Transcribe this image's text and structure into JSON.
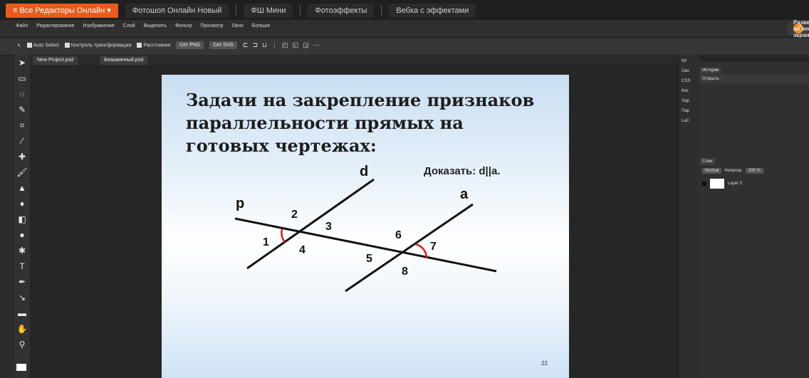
{
  "topbar": {
    "tabs": [
      {
        "label": "≡ Все Редакторы Онлайн ▾",
        "active": true
      },
      {
        "label": "Фотошоп Онлайн Новый"
      },
      {
        "label": "ФШ Мини"
      },
      {
        "label": "Фотоэффекты"
      },
      {
        "label": "Вебка с эффектами"
      }
    ]
  },
  "menubar": {
    "items": [
      "Файл",
      "Редактирование",
      "Изображение",
      "Слой",
      "Выделить",
      "Фильтр",
      "Просмотр",
      "Окно",
      "Больше"
    ],
    "expand_label": "Развернуть на весь экран"
  },
  "options": {
    "auto_select": "Auto Select",
    "transform": "Контроль трансформации",
    "distances": "Расстояния",
    "export_png": "Сет PNG",
    "export_svg": "Сет SVG"
  },
  "documents": {
    "tabs": [
      "New Project.psd",
      "Безымянный.psd"
    ]
  },
  "slide": {
    "title": "Задачи на закрепление признаков параллельности прямых на готовых чертежах:",
    "goal": "Доказать: d||a.",
    "labels": {
      "p": "p",
      "d": "d",
      "a": "a",
      "n1": "1",
      "n2": "2",
      "n3": "3",
      "n4": "4",
      "n5": "5",
      "n6": "6",
      "n7": "7",
      "n8": "8"
    },
    "page_number": "22"
  },
  "right_strip": [
    "Inf",
    "Сво",
    "CSS",
    "Кис",
    "Хар",
    "Пар",
    "LaC"
  ],
  "history": {
    "tab": "История",
    "item": "Открыть"
  },
  "layers": {
    "tab": "Слои",
    "blend": "Normal",
    "opacity_label": "Непрозр.",
    "opacity_value": "100 %",
    "layer_name": "Layer 0"
  }
}
